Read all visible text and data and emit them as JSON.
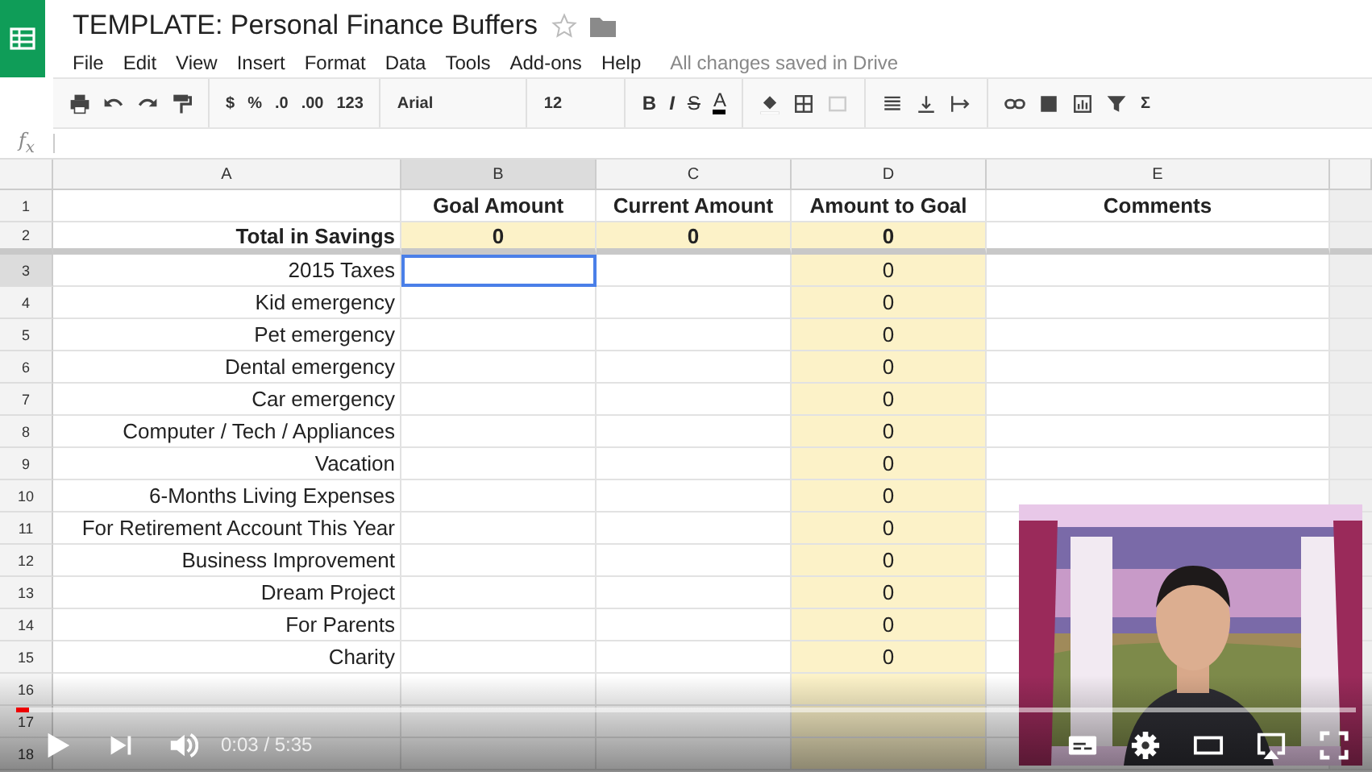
{
  "document": {
    "title": "TEMPLATE: Personal Finance Buffers",
    "starred": false,
    "save_status": "All changes saved in Drive"
  },
  "menu": [
    "File",
    "Edit",
    "View",
    "Insert",
    "Format",
    "Data",
    "Tools",
    "Add-ons",
    "Help"
  ],
  "toolbar": {
    "number_formats": [
      ".0",
      ".00",
      "123"
    ],
    "currency": "$",
    "percent": "%",
    "font": "Arial",
    "font_size": "12",
    "text_styles": [
      "B",
      "I",
      "S",
      "A"
    ],
    "sum": "Σ"
  },
  "formula_bar": {
    "label": "f$_{x}$"
  },
  "columns": [
    {
      "letter": "A",
      "selected": false
    },
    {
      "letter": "B",
      "selected": true
    },
    {
      "letter": "C",
      "selected": false
    },
    {
      "letter": "D",
      "selected": false
    },
    {
      "letter": "E",
      "selected": false
    }
  ],
  "rows": [
    {
      "number": "1",
      "kind": "header",
      "selected": false,
      "cells": [
        {
          "fill": false
        },
        {
          "text": "Goal Amount",
          "fill": false
        },
        {
          "text": "Current Amount",
          "fill": false
        },
        {
          "text": "Amount to Goal",
          "fill": false
        },
        {
          "text": "Comments",
          "fill": false
        }
      ]
    },
    {
      "number": "2",
      "kind": "total",
      "selected": false,
      "cells": [
        {
          "text": "Total in Savings",
          "fill": false
        },
        {
          "text": "0",
          "fill": true
        },
        {
          "text": "0",
          "fill": true
        },
        {
          "text": "0",
          "fill": true
        },
        {
          "fill": false
        }
      ]
    },
    {
      "number": "3",
      "kind": "item",
      "selected": true,
      "cells": [
        {
          "text": "2015 Taxes",
          "fill": false
        },
        {
          "fill": false,
          "selected": true
        },
        {
          "fill": false
        },
        {
          "text": "0",
          "fill": true
        },
        {
          "fill": false
        }
      ]
    },
    {
      "number": "4",
      "kind": "item",
      "selected": false,
      "cells": [
        {
          "text": "Kid emergency",
          "fill": false
        },
        {
          "fill": false
        },
        {
          "fill": false
        },
        {
          "text": "0",
          "fill": true
        },
        {
          "fill": false
        }
      ]
    },
    {
      "number": "5",
      "kind": "item",
      "selected": false,
      "cells": [
        {
          "text": "Pet emergency",
          "fill": false
        },
        {
          "fill": false
        },
        {
          "fill": false
        },
        {
          "text": "0",
          "fill": true
        },
        {
          "fill": false
        }
      ]
    },
    {
      "number": "6",
      "kind": "item",
      "selected": false,
      "cells": [
        {
          "text": "Dental emergency",
          "fill": false
        },
        {
          "fill": false
        },
        {
          "fill": false
        },
        {
          "text": "0",
          "fill": true
        },
        {
          "fill": false
        }
      ]
    },
    {
      "number": "7",
      "kind": "item",
      "selected": false,
      "cells": [
        {
          "text": "Car emergency",
          "fill": false
        },
        {
          "fill": false
        },
        {
          "fill": false
        },
        {
          "text": "0",
          "fill": true
        },
        {
          "fill": false
        }
      ]
    },
    {
      "number": "8",
      "kind": "item",
      "selected": false,
      "cells": [
        {
          "text": "Computer / Tech / Appliances",
          "fill": false
        },
        {
          "fill": false
        },
        {
          "fill": false
        },
        {
          "text": "0",
          "fill": true
        },
        {
          "fill": false
        }
      ]
    },
    {
      "number": "9",
      "kind": "item",
      "selected": false,
      "cells": [
        {
          "text": "Vacation",
          "fill": false
        },
        {
          "fill": false
        },
        {
          "fill": false
        },
        {
          "text": "0",
          "fill": true
        },
        {
          "fill": false
        }
      ]
    },
    {
      "number": "10",
      "kind": "item",
      "selected": false,
      "cells": [
        {
          "text": "6-Months Living Expenses",
          "fill": false
        },
        {
          "fill": false
        },
        {
          "fill": false
        },
        {
          "text": "0",
          "fill": true
        },
        {
          "fill": false
        }
      ]
    },
    {
      "number": "11",
      "kind": "item",
      "selected": false,
      "cells": [
        {
          "text": "For Retirement Account This Year",
          "fill": false
        },
        {
          "fill": false
        },
        {
          "fill": false
        },
        {
          "text": "0",
          "fill": true
        },
        {
          "fill": false
        }
      ]
    },
    {
      "number": "12",
      "kind": "item",
      "selected": false,
      "cells": [
        {
          "text": "Business Improvement",
          "fill": false
        },
        {
          "fill": false
        },
        {
          "fill": false
        },
        {
          "text": "0",
          "fill": true
        },
        {
          "fill": false
        }
      ]
    },
    {
      "number": "13",
      "kind": "item",
      "selected": false,
      "cells": [
        {
          "text": "Dream Project",
          "fill": false
        },
        {
          "fill": false
        },
        {
          "fill": false
        },
        {
          "text": "0",
          "fill": true
        },
        {
          "fill": false
        }
      ]
    },
    {
      "number": "14",
      "kind": "item",
      "selected": false,
      "cells": [
        {
          "text": "For Parents",
          "fill": false
        },
        {
          "fill": false
        },
        {
          "fill": false
        },
        {
          "text": "0",
          "fill": true
        },
        {
          "fill": false
        }
      ]
    },
    {
      "number": "15",
      "kind": "item",
      "selected": false,
      "cells": [
        {
          "text": "Charity",
          "fill": false
        },
        {
          "fill": false
        },
        {
          "fill": false
        },
        {
          "text": "0",
          "fill": true
        },
        {
          "fill": false
        }
      ]
    },
    {
      "number": "16",
      "kind": "item",
      "selected": false,
      "cells": [
        {
          "fill": false
        },
        {
          "fill": false
        },
        {
          "fill": false
        },
        {
          "fill": true
        },
        {
          "fill": false
        }
      ]
    },
    {
      "number": "17",
      "kind": "item",
      "selected": false,
      "cells": [
        {
          "fill": false
        },
        {
          "fill": false
        },
        {
          "fill": false
        },
        {
          "fill": true
        },
        {
          "fill": false
        }
      ]
    },
    {
      "number": "18",
      "kind": "item",
      "selected": false,
      "cells": [
        {
          "fill": false
        },
        {
          "fill": false
        },
        {
          "fill": false
        },
        {
          "fill": true
        },
        {
          "fill": false
        }
      ]
    }
  ],
  "player": {
    "time": "0:03 / 5:35",
    "level": 0.01
  }
}
